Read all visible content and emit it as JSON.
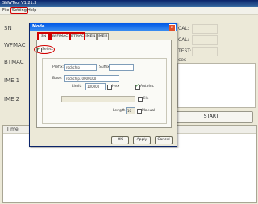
{
  "window": {
    "title": "SNWTool V1.21.3"
  },
  "menu": [
    {
      "label": "File",
      "highlight": false
    },
    {
      "label": "Setting",
      "highlight": true
    },
    {
      "label": "Help",
      "highlight": false
    }
  ],
  "main": {
    "labels": [
      "SN",
      "WFMAC",
      "BTMAC",
      "IMEI1",
      "IMEI2"
    ],
    "right_labels": [
      "CAL:",
      "CAL:",
      "TEST:"
    ],
    "right_label_top": "ces",
    "start_label": "START",
    "time_header": "Time"
  },
  "dialog": {
    "title": "Mode",
    "close_glyph": "x",
    "tabs": [
      {
        "label": "SN",
        "highlight": true
      },
      {
        "label": "WIFIMAC",
        "highlight": true
      },
      {
        "label": "BTMAC",
        "highlight": true
      },
      {
        "label": "IMEI1",
        "highlight": false
      },
      {
        "label": "IMEI2",
        "highlight": false
      }
    ],
    "select_label": "Select",
    "prefix_label": "Prefix:",
    "prefix_value": "rockchip",
    "suffix_label": "Suffix:",
    "suffix_value": "",
    "base_label": "Base:",
    "base_value": "rockchip10000100",
    "limit_label": "Limit:",
    "limit_value": "100000",
    "hex_label": "Hex",
    "autoinc_label": "AutoInc",
    "file_label": "File",
    "length_label": "Length:",
    "length_value": "10",
    "manual_label": "Manual",
    "ok_label": "OK",
    "apply_label": "Apply",
    "cancel_label": "Cancel"
  }
}
